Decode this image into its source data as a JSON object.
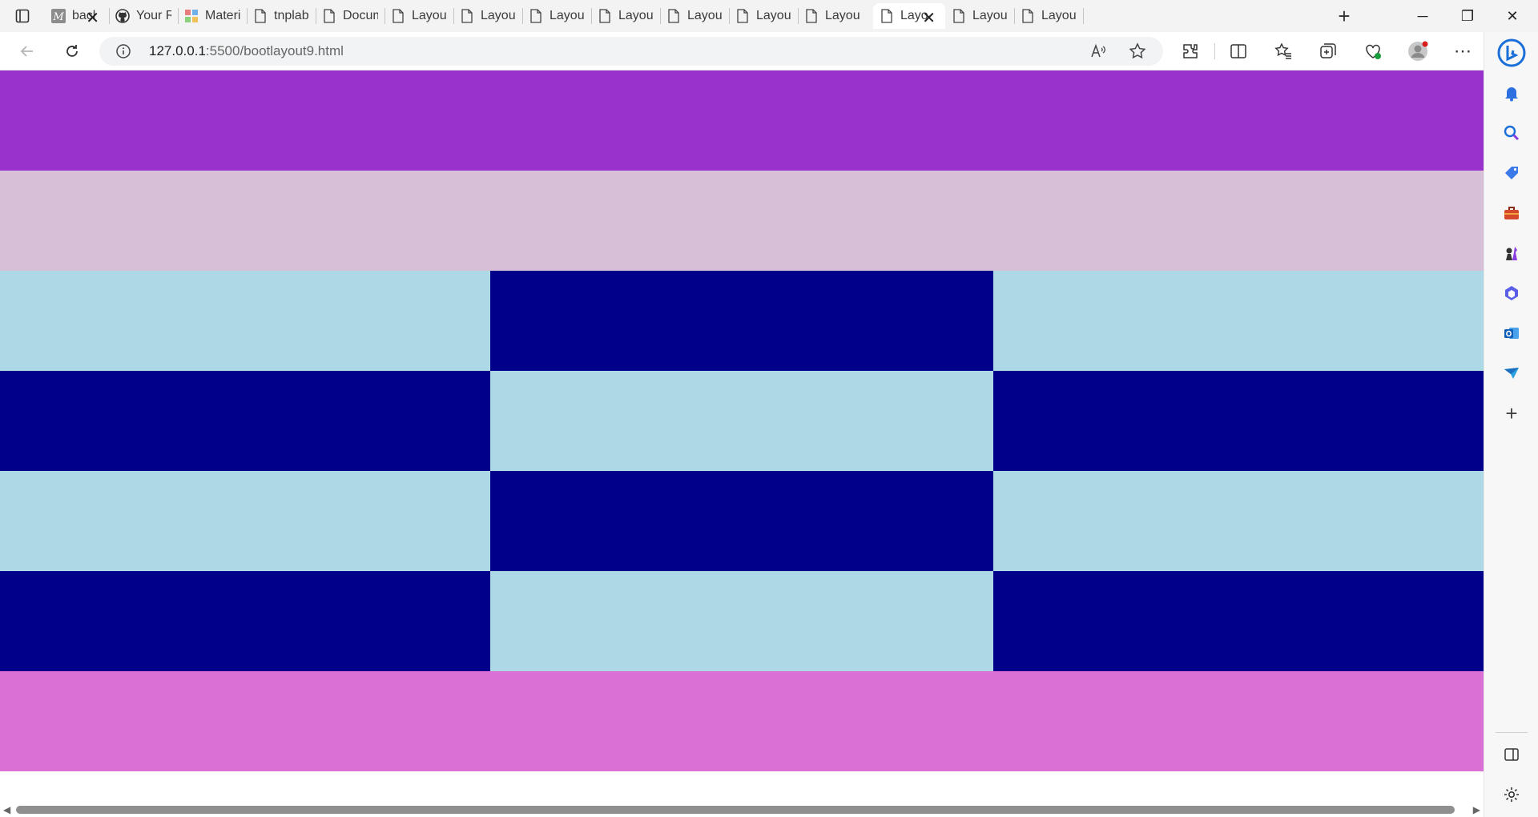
{
  "browser": {
    "tabs": [
      {
        "title": "bacl",
        "favicon": "m-letter-icon"
      },
      {
        "title": "Your Rep",
        "favicon": "github-icon"
      },
      {
        "title": "Material",
        "favicon": "material-icon"
      },
      {
        "title": "tnplab",
        "favicon": "page-icon"
      },
      {
        "title": "Documer",
        "favicon": "page-icon"
      },
      {
        "title": "Layout b",
        "favicon": "page-icon"
      },
      {
        "title": "Layout b",
        "favicon": "page-icon"
      },
      {
        "title": "Layout b",
        "favicon": "page-icon"
      },
      {
        "title": "Layout b",
        "favicon": "page-icon"
      },
      {
        "title": "Layout b",
        "favicon": "page-icon"
      },
      {
        "title": "Layout b",
        "favicon": "page-icon"
      },
      {
        "title": "Layout b",
        "favicon": "page-icon"
      },
      {
        "title": "Layo",
        "favicon": "page-icon",
        "active": true
      },
      {
        "title": "Layout b",
        "favicon": "page-icon"
      },
      {
        "title": "Layout b",
        "favicon": "page-icon"
      }
    ],
    "address": {
      "host": "127.0.0.1",
      "rest": ":5500/bootlayout9.html"
    },
    "controls": {
      "minimize": "─",
      "restore": "❐",
      "close": "✕",
      "new_tab": "+"
    }
  },
  "page": {
    "colors": {
      "purple": "#9932cc",
      "thistle": "#d8bfd8",
      "lightblue": "#add8e6",
      "darkblue": "#00008b",
      "orchid": "#da70d6"
    },
    "rows": [
      {
        "name": "header-band",
        "cells": [
          "purple"
        ]
      },
      {
        "name": "subheader-band",
        "cells": [
          "thistle"
        ]
      },
      {
        "name": "grid-row-1",
        "cells": [
          "lightblue",
          "darkblue",
          "lightblue"
        ]
      },
      {
        "name": "grid-row-2",
        "cells": [
          "darkblue",
          "lightblue",
          "darkblue"
        ]
      },
      {
        "name": "grid-row-3",
        "cells": [
          "lightblue",
          "darkblue",
          "lightblue"
        ]
      },
      {
        "name": "grid-row-4",
        "cells": [
          "darkblue",
          "lightblue",
          "darkblue"
        ]
      },
      {
        "name": "footer-band",
        "cells": [
          "orchid"
        ]
      }
    ]
  },
  "sidebar": {
    "icons": [
      "bell-icon",
      "search-icon",
      "tag-icon",
      "briefcase-icon",
      "chess-icon",
      "m365-icon",
      "outlook-icon",
      "send-icon",
      "add-icon"
    ],
    "bottom": [
      "split-panel-icon",
      "settings-icon"
    ]
  }
}
